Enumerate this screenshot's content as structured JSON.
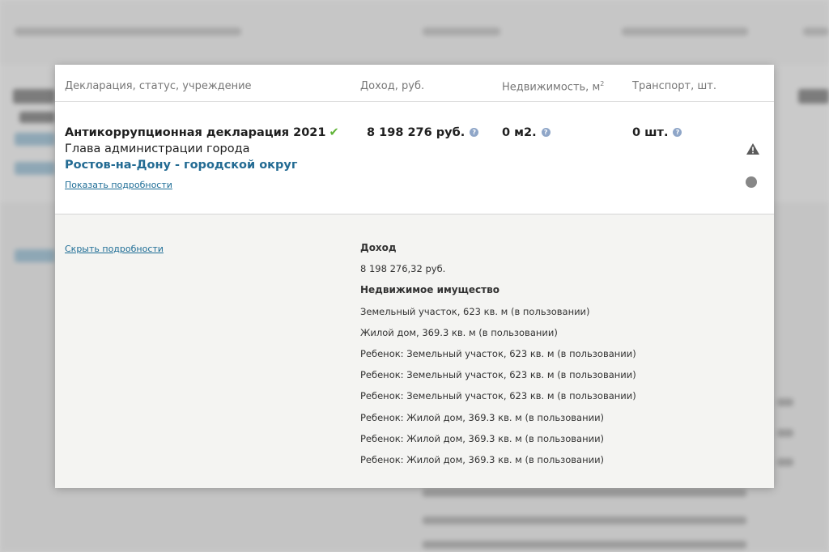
{
  "modal": {
    "headers": {
      "declaration": "Декларация, статус, учреждение",
      "income": "Доход, руб.",
      "realty": "Недвижимость, м",
      "realty_sup": "2",
      "transport": "Транспорт, шт."
    },
    "declaration": {
      "title": "Антикоррупционная декларация 2021",
      "check_icon": "✔",
      "position": "Глава администрации города",
      "organization": "Ростов-на-Дону - городской округ",
      "show_details": "Показать подробности",
      "income": "8 198 276 руб.",
      "realty": "0 м2.",
      "transport": "0 шт.",
      "help_icon": "?"
    },
    "details": {
      "hide_details": "Скрыть подробности",
      "items": [
        {
          "text": "Доход",
          "bold": true
        },
        {
          "text": "8 198 276,32 руб.",
          "bold": false
        },
        {
          "text": "Недвижимое имущество",
          "bold": true
        },
        {
          "text": "Земельный участок, 623 кв. м (в пользовании)",
          "bold": false
        },
        {
          "text": "Жилой дом, 369.3 кв. м (в пользовании)",
          "bold": false
        },
        {
          "text": "Ребенок: Земельный участок, 623 кв. м (в пользовании)",
          "bold": false
        },
        {
          "text": "Ребенок: Земельный участок, 623 кв. м (в пользовании)",
          "bold": false
        },
        {
          "text": "Ребенок: Земельный участок, 623 кв. м (в пользовании)",
          "bold": false
        },
        {
          "text": "Ребенок: Жилой дом, 369.3 кв. м (в пользовании)",
          "bold": false
        },
        {
          "text": "Ребенок: Жилой дом, 369.3 кв. м (в пользовании)",
          "bold": false
        },
        {
          "text": "Ребенок: Жилой дом, 369.3 кв. м (в пользовании)",
          "bold": false
        }
      ]
    }
  },
  "colors": {
    "org_link": "#236b93",
    "check": "#5fb336",
    "details_bg": "#f4f4f2"
  }
}
